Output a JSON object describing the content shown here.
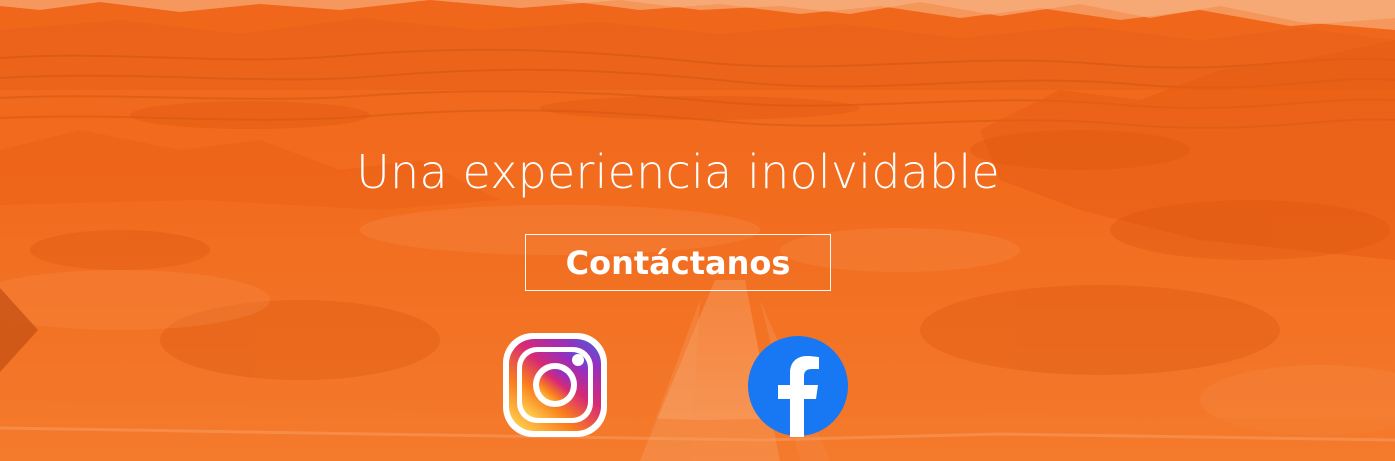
{
  "hero": {
    "headline": "Una experiencia inolvidable",
    "cta_label": "Contáctanos"
  },
  "social": {
    "instagram_icon": "instagram-icon",
    "facebook_icon": "facebook-icon"
  },
  "colors": {
    "overlay": "#f26a1b",
    "text": "#ffffff",
    "facebook_blue": "#1877f2"
  }
}
